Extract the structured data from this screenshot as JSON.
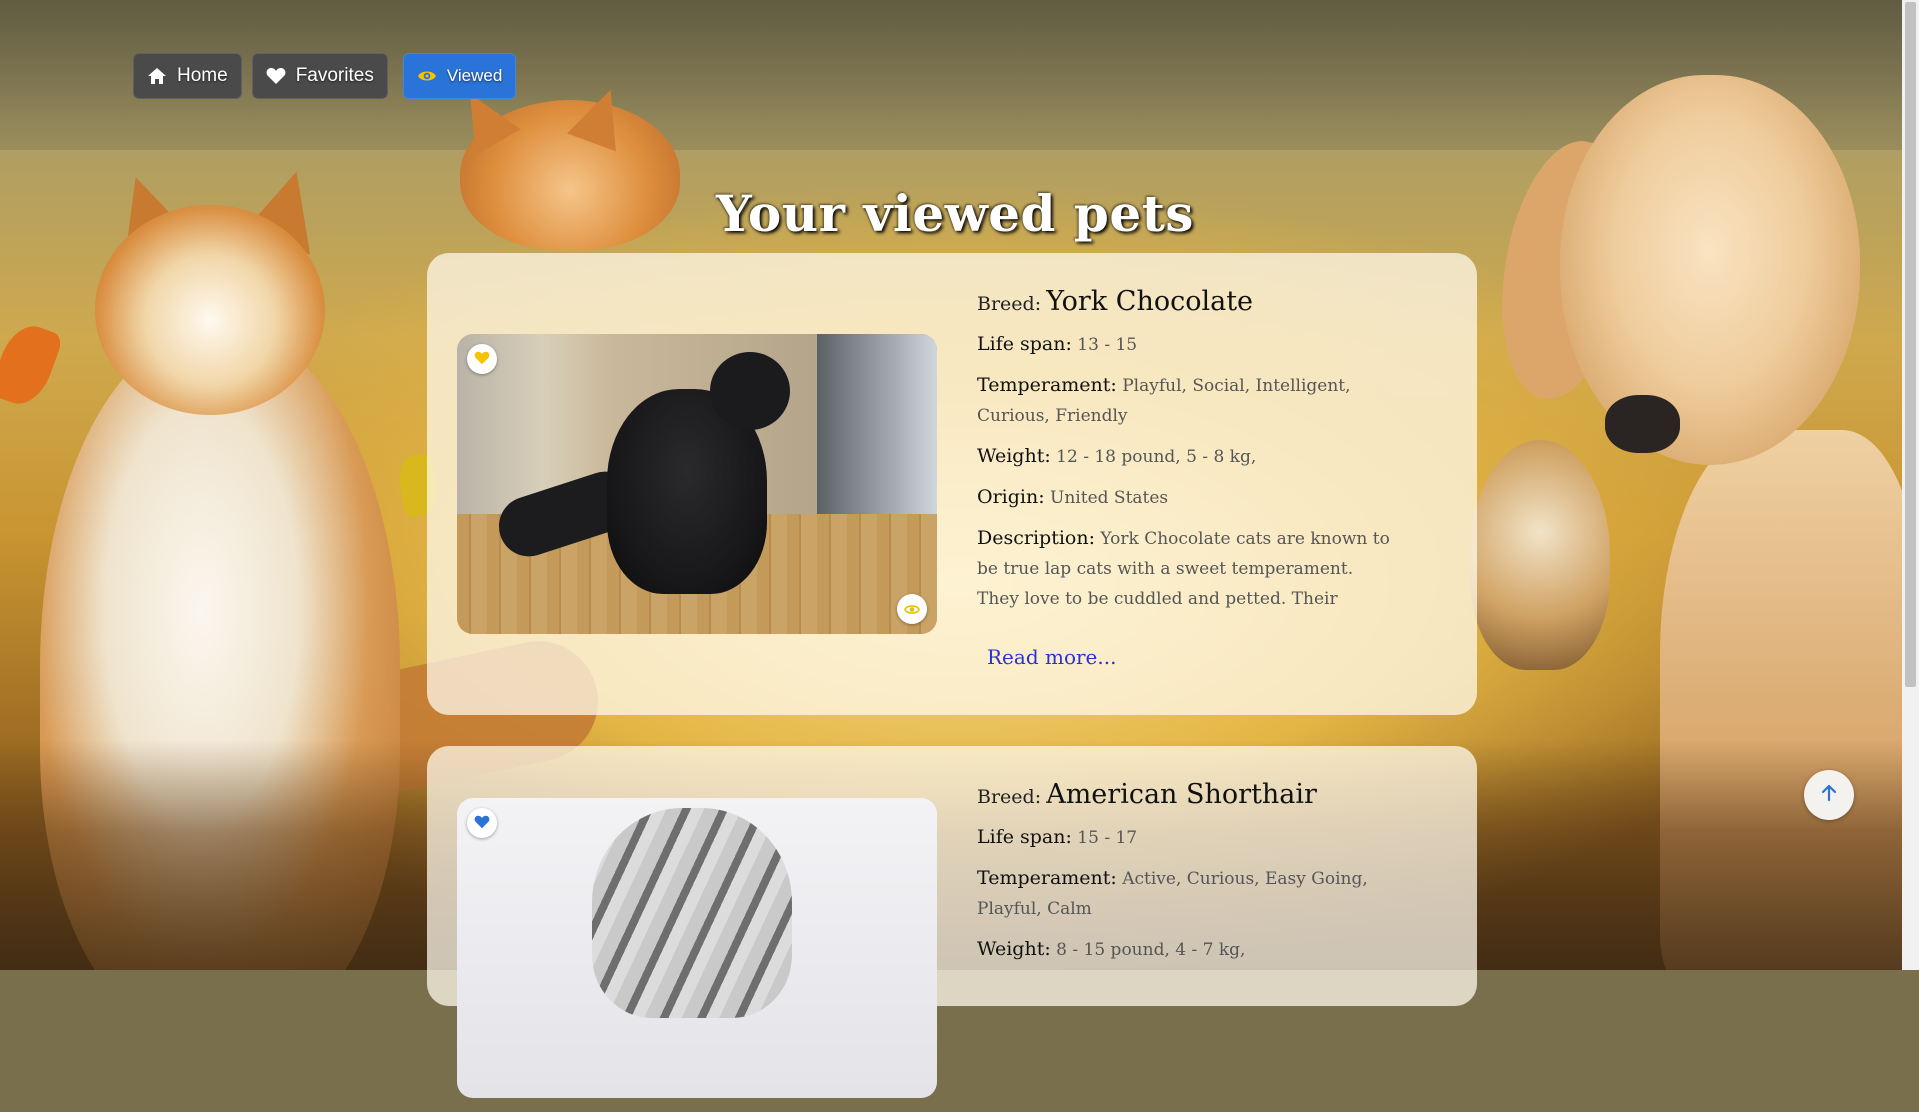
{
  "nav": {
    "home_label": "Home",
    "favorites_label": "Favorites",
    "viewed_label": "Viewed"
  },
  "page": {
    "title": "Your viewed pets"
  },
  "labels": {
    "breed": "Breed:",
    "life_span": "Life span:",
    "temperament": "Temperament:",
    "weight": "Weight:",
    "origin": "Origin:",
    "description": "Description:",
    "read_more": "Read more..."
  },
  "pets": [
    {
      "breed": "York Chocolate",
      "life_span": "13 - 15",
      "temperament": "Playful, Social, Intelligent, Curious, Friendly",
      "weight": "12 - 18 pound, 5 - 8 kg,",
      "origin": "United States",
      "description": "York Chocolate cats are known to be true lap cats with a sweet temperament. They love to be cuddled and petted. Their curious nature makes them",
      "favorite_color": "#f5c400"
    },
    {
      "breed": "American Shorthair",
      "life_span": "15 - 17",
      "temperament": "Active, Curious, Easy Going, Playful, Calm",
      "weight": "8 - 15 pound, 4 - 7 kg,",
      "favorite_color": "#2a73d8"
    }
  ],
  "icons": {
    "home": "home-icon",
    "favorites": "heart-icon",
    "viewed": "eye-icon",
    "scroll_top": "arrow-up-icon"
  },
  "colors": {
    "accent": "#2a73d8",
    "link": "#2632d8",
    "nav_button": "#4a4a4a"
  }
}
